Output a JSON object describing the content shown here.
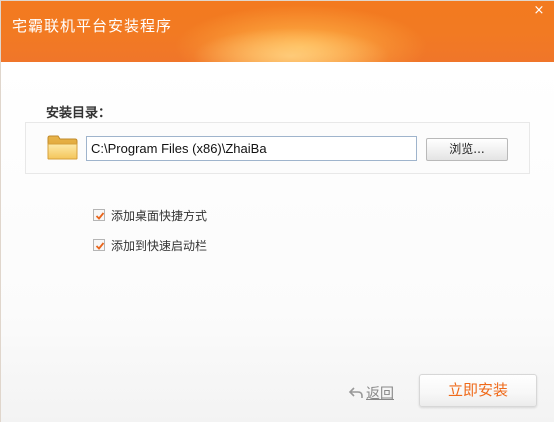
{
  "window": {
    "title": "宅霸联机平台安装程序",
    "close_symbol": "×",
    "accent_color": "#f27a22"
  },
  "install_dir": {
    "label": "安装目录：",
    "path_value": "C:\\Program Files (x86)\\ZhaiBa",
    "browse_label": "浏览...",
    "folder_icon": "folder-icon"
  },
  "options": [
    {
      "label": "添加桌面快捷方式",
      "checked": true
    },
    {
      "label": "添加到快速启动栏",
      "checked": true
    }
  ],
  "footer": {
    "back_label": "返回",
    "back_icon": "back-arrow-icon",
    "install_label": "立即安装",
    "install_color": "#ef6a1a"
  }
}
